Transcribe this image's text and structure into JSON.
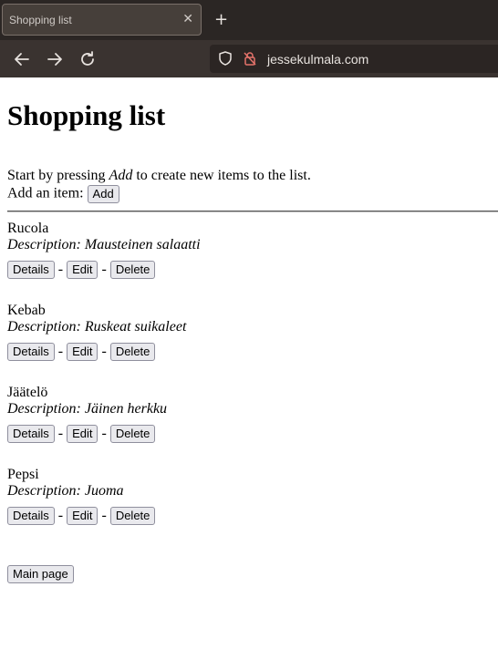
{
  "browser": {
    "tab_title": "Shopping list",
    "tab_close": "✕",
    "new_tab": "+",
    "url": "jessekulmala.com"
  },
  "page": {
    "title": "Shopping list",
    "intro_before": "Start by pressing ",
    "intro_em": "Add",
    "intro_after": " to create new items to the list.",
    "add_label": "Add an item: ",
    "add_button": "Add",
    "separator": "-",
    "details_label": "Details",
    "edit_label": "Edit",
    "delete_label": "Delete",
    "main_page_button": "Main page",
    "items": [
      {
        "name": "Rucola",
        "description": "Description: Mausteinen salaatti"
      },
      {
        "name": "Kebab",
        "description": "Description: Ruskeat suikaleet"
      },
      {
        "name": "Jäätelö",
        "description": "Description: Jäinen herkku"
      },
      {
        "name": "Pepsi",
        "description": "Description: Juoma"
      }
    ]
  }
}
